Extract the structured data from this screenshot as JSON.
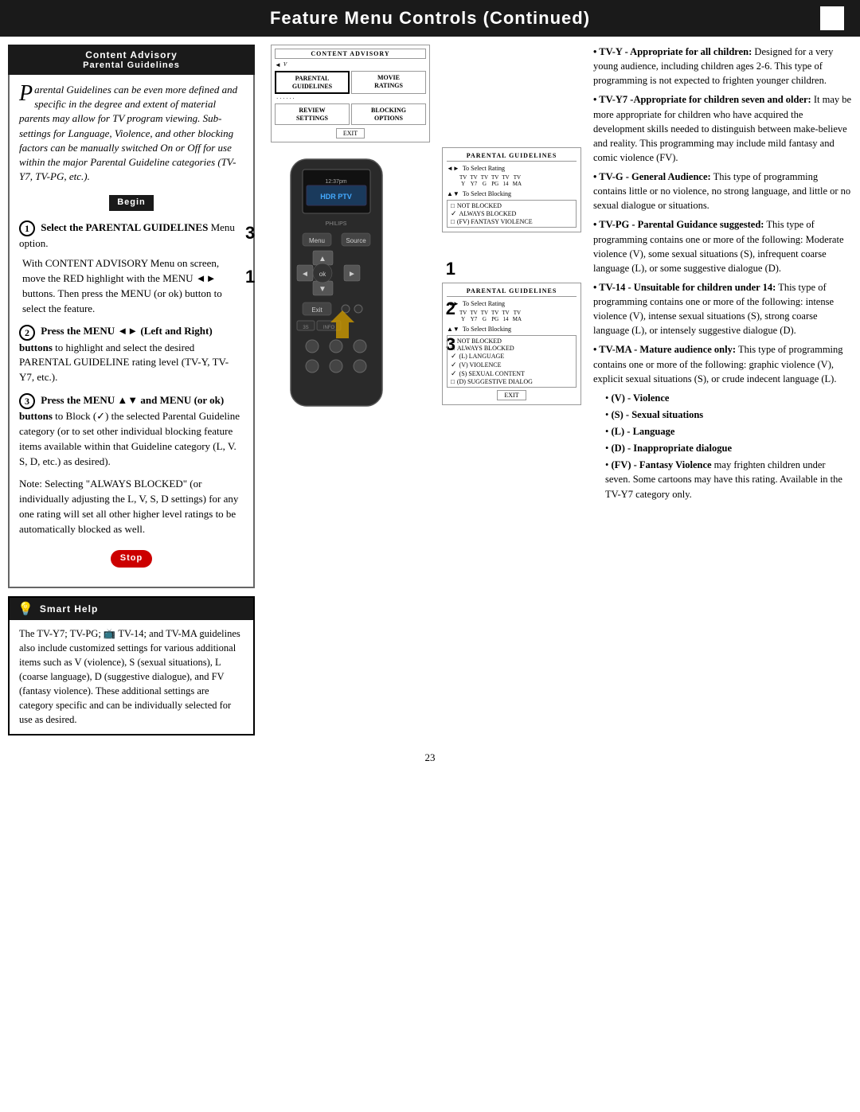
{
  "header": {
    "title": "Feature Menu Controls (Continued)",
    "corner": ""
  },
  "content_advisory_section": {
    "header_line1": "Content Advisory",
    "header_line2": "Parental Guidelines",
    "intro_text": "arental Guidelines can be even more defined and specific in the degree and extent of material parents may allow for TV program viewing. Sub-settings for Language, Violence, and other blocking factors can be manually switched On or Off for use within the major Parental Guideline categories (TV-Y7, TV-PG, etc.).",
    "drop_cap": "P",
    "begin_label": "Begin",
    "steps": [
      {
        "number": "1",
        "title": "Select the PARENTAL GUIDELINES",
        "body": " Menu option.",
        "detail": "With CONTENT ADVISORY Menu on screen, move the RED highlight with the MENU ◄► buttons. Then press the MENU (or ok) button to select the feature."
      },
      {
        "number": "2",
        "title": "Press the MENU ◄► (Left and Right) buttons",
        "body": " to highlight and select the desired PARENTAL GUIDELINE rating level (TV-Y, TV-Y7, etc.)."
      },
      {
        "number": "3",
        "title": "Press the MENU ▲▼ and MENU (or ok) buttons",
        "body": " to Block (✓) the selected Parental Guideline category (or to set other individual blocking feature items available within that Guideline category (L, V. S, D, etc.) as desired)."
      }
    ],
    "note_text": "Note: Selecting \"ALWAYS BLOCKED\" (or individually adjusting the L, V, S, D settings) for any one rating will set all other higher level ratings to be automatically blocked as well.",
    "stop_label": "Stop"
  },
  "smart_help": {
    "title": "Smart Help",
    "bulb": "💡",
    "content": "The TV-Y7; TV-PG; TV-14; and TV-MA guidelines also include customized settings for various additional items such as V (violence), S (sexual situations), L (coarse language), D (suggestive dialogue), and FV (fantasy violence). These additional settings are category specific and can be individually selected for use as desired."
  },
  "menu_diagram": {
    "title": "Content Advisory",
    "cells": [
      {
        "label": "PARENTAL\nGUIDELINES",
        "selected": true
      },
      {
        "label": "MOVIE\nRATINGS",
        "selected": false
      },
      {
        "label": "REVIEW\nSETTINGS",
        "selected": false
      },
      {
        "label": "BLOCKING\nOPTIONS",
        "selected": false
      }
    ],
    "exit_label": "EXIT"
  },
  "tv_brand": "HDR PTV",
  "remote_labels": {
    "menu": "Menu",
    "source": "Source",
    "ok": "ok",
    "exit": "Exit",
    "info": "INFO"
  },
  "pg_box1": {
    "title": "PARENTAL GUIDELINES",
    "arrow_label": "◄► To Select Rating",
    "ratings": [
      {
        "line1": "TV",
        "line2": "Y"
      },
      {
        "line1": "TV",
        "line2": "Y7"
      },
      {
        "line1": "TV",
        "line2": "G"
      },
      {
        "line1": "TV",
        "line2": "PG"
      },
      {
        "line1": "TV",
        "line2": "14"
      },
      {
        "line1": "TV",
        "line2": "MA"
      }
    ],
    "blocking_label": "▲▼ To Select Blocking",
    "blocking_options": [
      {
        "check": false,
        "label": "NOT BLOCKED"
      },
      {
        "check": true,
        "label": "ALWAYS BLOCKED"
      },
      {
        "check": false,
        "label": "(FV) FANTASY VIOLENCE"
      }
    ]
  },
  "pg_box2": {
    "title": "PARENTAL GUIDELINES",
    "arrow_label": "◄► To Select Rating",
    "ratings": [
      {
        "line1": "TV",
        "line2": "Y"
      },
      {
        "line1": "TV",
        "line2": "Y7"
      },
      {
        "line1": "TV",
        "line2": "G"
      },
      {
        "line1": "TV",
        "line2": "PG"
      },
      {
        "line1": "TV",
        "line2": "14"
      },
      {
        "line1": "TV",
        "line2": "MA"
      }
    ],
    "blocking_label": "▲▼ To Select Blocking",
    "blocking_options": [
      {
        "check": false,
        "label": "NOT BLOCKED"
      },
      {
        "check": false,
        "label": "ALWAYS BLOCKED"
      },
      {
        "check": true,
        "label": "(L) LANGUAGE"
      },
      {
        "check": true,
        "label": "(V) VIOLENCE"
      },
      {
        "check": true,
        "label": "(S) SEXUAL CONTENT"
      },
      {
        "check": false,
        "label": "(D) SUGGESTIVE DIALOG"
      }
    ],
    "exit_label": "EXIT"
  },
  "right_text": {
    "paragraphs": [
      {
        "bold_start": "TV-Y - Appropriate for all children:",
        "rest": " Designed for a very young audience, including children ages 2-6. This type of programming is not expected to frighten younger children."
      },
      {
        "bold_start": "TV-Y7 -Appropriate for children seven and older:",
        "rest": " It may be more appropriate for children who have acquired the development skills needed to distinguish between make-believe and reality. This programming may include mild fantasy and comic violence (FV)."
      },
      {
        "bold_start": "TV-G - General Audience:",
        "rest": " This type of programming contains little or no violence, no strong language, and little or no sexual dialogue or situations."
      },
      {
        "bold_start": "TV-PG - Parental Guidance suggested:",
        "rest": " This type of programming contains one or more of the following: Moderate violence (V), some sexual situations (S), infrequent coarse language (L), or some suggestive dialogue (D)."
      },
      {
        "bold_start": "TV-14 - Unsuitable for children under 14:",
        "rest": " This type of programming contains one or more of the following: intense violence (V), intense sexual situations (S), strong coarse language (L), or intensely suggestive dialogue (D)."
      },
      {
        "bold_start": "TV-MA - Mature audience only:",
        "rest": " This type of programming contains one or more of the following: graphic violence (V), explicit sexual situations (S), or crude indecent language (L)."
      }
    ],
    "bullets": [
      {
        "bold": "(V) - Violence",
        "rest": ""
      },
      {
        "bold": "(S) - Sexual situations",
        "rest": ""
      },
      {
        "bold": "(L) - Language",
        "rest": ""
      },
      {
        "bold": "(D) - Inappropriate dialogue",
        "rest": ""
      },
      {
        "bold": "(FV) - Fantasy Violence",
        "rest": " may frighten children under seven. Some cartoons may have this rating. Available in the TV-Y7 category only."
      }
    ]
  },
  "page_number": "23"
}
